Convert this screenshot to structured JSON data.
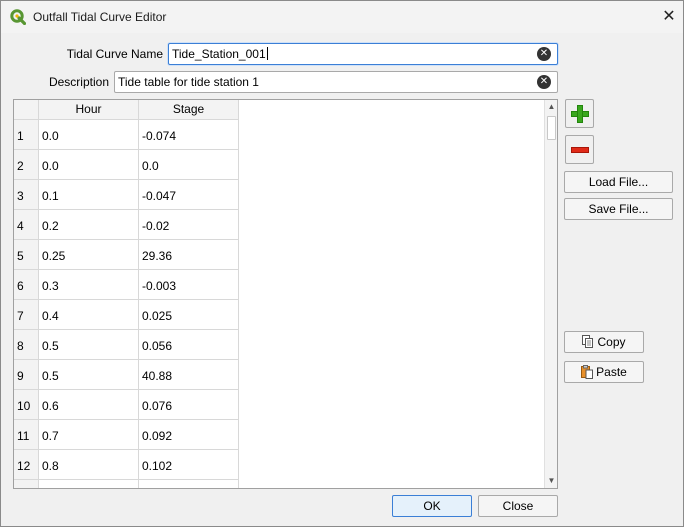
{
  "window": {
    "title": "Outfall Tidal Curve Editor",
    "close_glyph": "✕"
  },
  "form": {
    "name_label": "Tidal Curve Name",
    "name_value": "Tide_Station_001",
    "description_label": "Description",
    "description_value": "Tide table for tide station 1",
    "clear_glyph": "✕"
  },
  "table": {
    "headers": [
      "Hour",
      "Stage"
    ],
    "rows": [
      {
        "num": "1",
        "hour": "0.0",
        "stage": "-0.074"
      },
      {
        "num": "2",
        "hour": "0.0",
        "stage": "0.0"
      },
      {
        "num": "3",
        "hour": "0.1",
        "stage": "-0.047"
      },
      {
        "num": "4",
        "hour": "0.2",
        "stage": "-0.02"
      },
      {
        "num": "5",
        "hour": "0.25",
        "stage": "29.36"
      },
      {
        "num": "6",
        "hour": "0.3",
        "stage": "-0.003"
      },
      {
        "num": "7",
        "hour": "0.4",
        "stage": "0.025"
      },
      {
        "num": "8",
        "hour": "0.5",
        "stage": "0.056"
      },
      {
        "num": "9",
        "hour": "0.5",
        "stage": "40.88"
      },
      {
        "num": "10",
        "hour": "0.6",
        "stage": "0.076"
      },
      {
        "num": "11",
        "hour": "0.7",
        "stage": "0.092"
      },
      {
        "num": "12",
        "hour": "0.8",
        "stage": "0.102"
      }
    ],
    "scroll_up_glyph": "▲",
    "scroll_down_glyph": "▼"
  },
  "side_buttons": {
    "add_icon": "plus-icon",
    "remove_icon": "minus-icon",
    "load_label": "Load File...",
    "save_label": "Save File...",
    "copy_label": "Copy",
    "paste_label": "Paste"
  },
  "footer": {
    "ok_label": "OK",
    "close_label": "Close"
  },
  "colors": {
    "accent": "#3b7fd6",
    "add_green": "#3aa81e",
    "remove_red": "#e02a18",
    "qgis_green": "#589632"
  }
}
